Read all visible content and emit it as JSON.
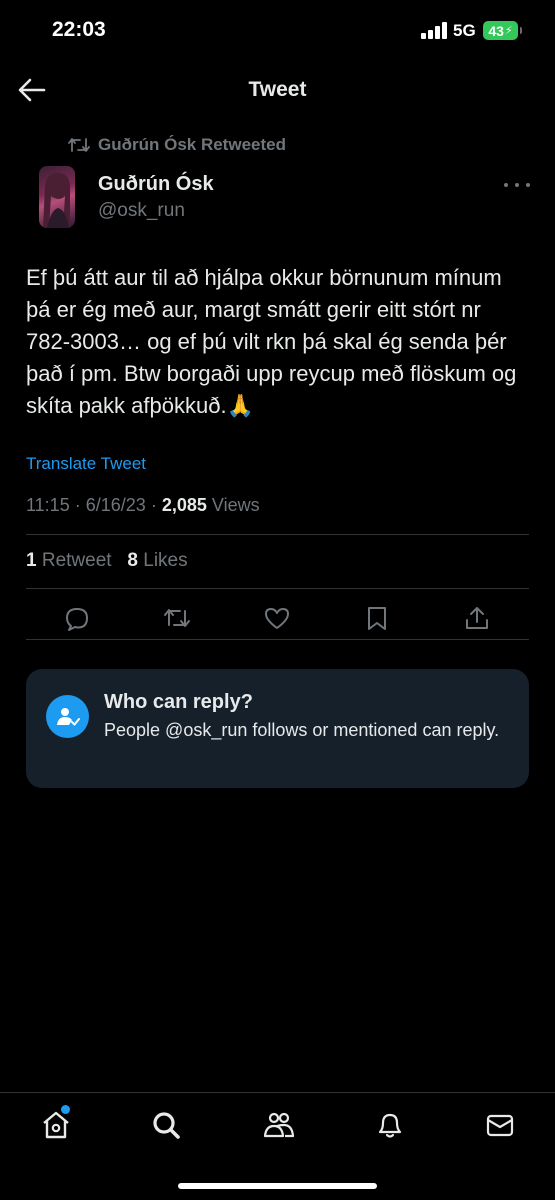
{
  "status_bar": {
    "time": "22:03",
    "network": "5G",
    "battery": "43"
  },
  "header": {
    "title": "Tweet"
  },
  "retweet_context": {
    "text": "Guðrún Ósk Retweeted"
  },
  "author": {
    "display_name": "Guðrún Ósk",
    "handle": "@osk_run"
  },
  "tweet": {
    "text": "Ef þú átt aur til að hjálpa okkur börnunum mínum þá er ég með aur, margt smátt gerir eitt stórt nr 782-3003… og ef þú vilt rkn þá skal ég senda þér það í pm. Btw borgaði upp reycup með flöskum og skíta pakk afþökkuð.🙏",
    "translate_label": "Translate Tweet",
    "time": "11:15",
    "date": "6/16/23",
    "separator": "·",
    "views_count": "2,085",
    "views_label": "Views"
  },
  "stats": {
    "retweets_count": "1",
    "retweets_label": "Retweet",
    "likes_count": "8",
    "likes_label": "Likes"
  },
  "reply_settings": {
    "title": "Who can reply?",
    "description": "People @osk_run follows or mentioned can reply."
  },
  "colors": {
    "accent": "#1d9bf0",
    "background": "#000000",
    "muted": "#71767b",
    "card": "#15202b",
    "battery": "#34c759"
  },
  "icons": {
    "actions": [
      "reply-icon",
      "retweet-icon",
      "like-icon",
      "bookmark-icon",
      "share-icon"
    ],
    "tabs": [
      "home-icon",
      "search-icon",
      "communities-icon",
      "notifications-icon",
      "messages-icon"
    ]
  }
}
